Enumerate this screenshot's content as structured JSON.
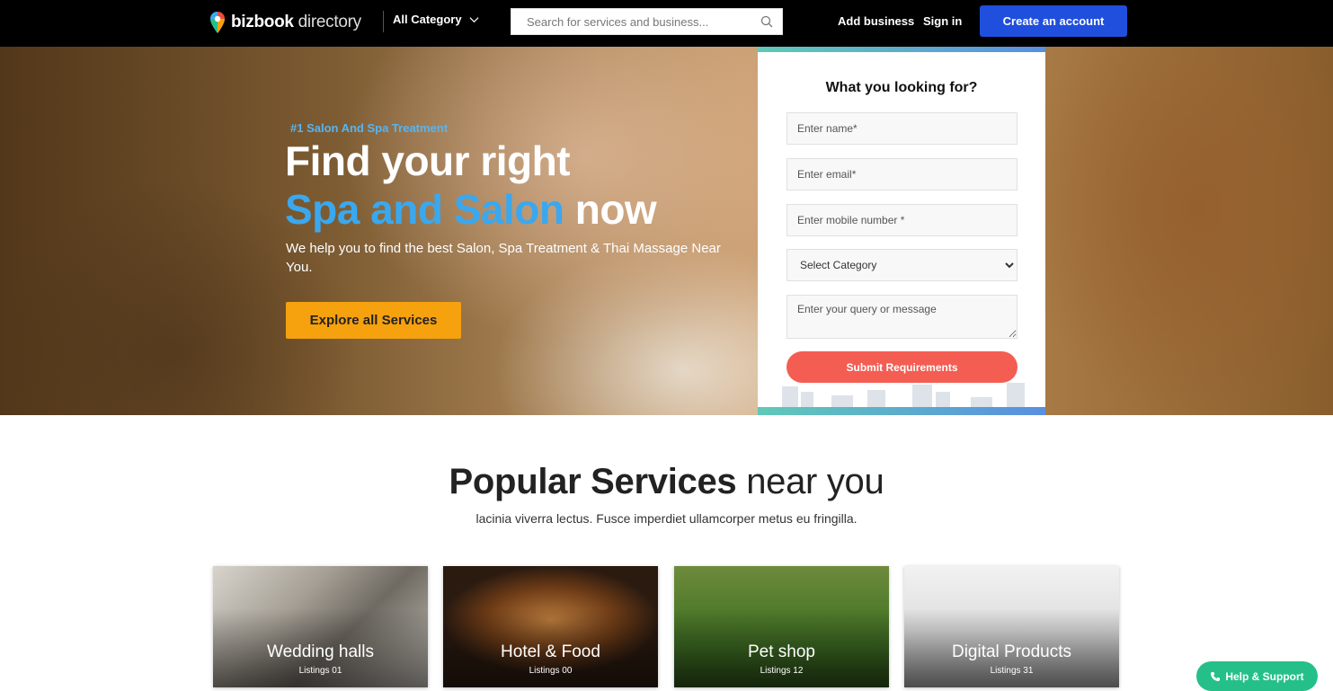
{
  "header": {
    "logo_bold": "bizbook",
    "logo_light": "directory",
    "category_label": "All Category",
    "search_placeholder": "Search for services and business...",
    "add_business": "Add business",
    "sign_in": "Sign in",
    "create_account": "Create an account"
  },
  "hero": {
    "tag": "#1 Salon And Spa Treatment",
    "title_line1": "Find your right",
    "title_blue": "Spa and Salon",
    "title_end": "now",
    "subtitle": "We help you to find the best Salon, Spa Treatment & Thai Massage Near You.",
    "cta": "Explore all Services"
  },
  "form": {
    "title": "What you looking for?",
    "name_placeholder": "Enter name*",
    "email_placeholder": "Enter email*",
    "mobile_placeholder": "Enter mobile number *",
    "category_selected": "Select Category",
    "message_placeholder": "Enter your query or message",
    "submit": "Submit Requirements"
  },
  "popular": {
    "title_bold": "Popular Services",
    "title_light": "near you",
    "subtitle": "lacinia viverra lectus. Fusce imperdiet ullamcorper metus eu fringilla.",
    "cards": [
      {
        "name": "Wedding halls",
        "count": "Listings 01"
      },
      {
        "name": "Hotel & Food",
        "count": "Listings 00"
      },
      {
        "name": "Pet shop",
        "count": "Listings 12"
      },
      {
        "name": "Digital Products",
        "count": "Listings 31"
      }
    ]
  },
  "help": {
    "label": "Help & Support"
  }
}
